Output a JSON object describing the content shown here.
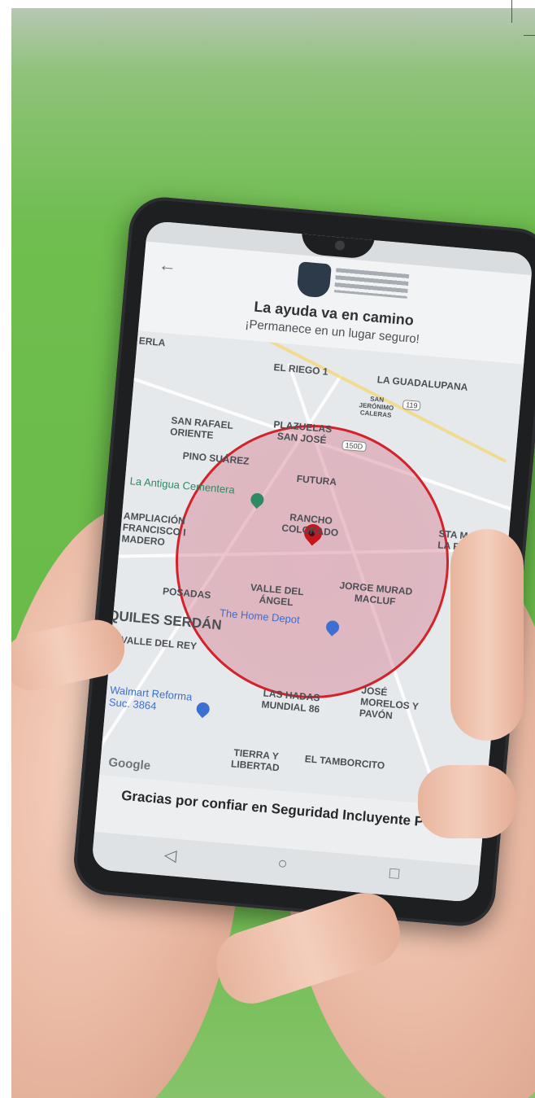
{
  "app": {
    "header": {
      "back_icon": "arrow-left-icon",
      "headline": "La ayuda va en camino",
      "subline": "¡Permanece en un lugar seguro!"
    },
    "map": {
      "labels": [
        "ERLA",
        "EL RIEGO 1",
        "LA GUADALUPANA",
        "SAN JERÓNIMO CALERAS",
        "SAN RAFAEL ORIENTE",
        "PLAZUELAS SAN JOSÉ",
        "PINO SUÁREZ",
        "FUTURA",
        "RANCHO COLORADO",
        "AMPLIACIÓN FRANCISCO I MADERO",
        "VALLE DEL ÁNGEL",
        "JORGE MURAD MACLUF",
        "POSADAS",
        "QUILES SERDÁN",
        "VALLE DEL REY",
        "LAS HADAS MUNDIAL 86",
        "JOSÉ MORELOS Y PAVÓN",
        "TIERRA Y LIBERTAD",
        "EL TAMBORCITO",
        "STA MARÍA LA RIVERA"
      ],
      "pois": [
        "La Antigua Cementera",
        "The Home Depot",
        "Walmart Reforma Suc. 3864"
      ],
      "shields": [
        "119",
        "150D"
      ],
      "attribution": "Google"
    },
    "footer": {
      "message": "Gracias por confiar en Seguridad Incluyente Puebla"
    },
    "nav": {
      "back": "◁",
      "home": "○",
      "recents": "□"
    },
    "colors": {
      "radius_stroke": "#d2232a",
      "pin": "#c4161c",
      "poi_green": "#2e8a62",
      "poi_blue": "#3c6fd1"
    }
  }
}
